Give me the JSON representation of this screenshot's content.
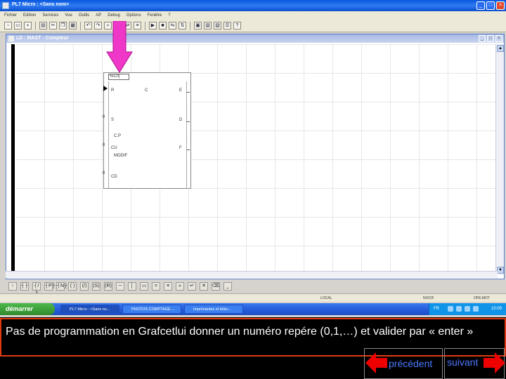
{
  "window": {
    "title": "PL7 Micro : <Sans nom>",
    "buttons": [
      "_",
      "□",
      "×"
    ]
  },
  "menu": [
    "Fichier",
    "Edition",
    "Services",
    "Vue",
    "Outils",
    "AP",
    "Debug",
    "Options",
    "Fenêtre",
    "?"
  ],
  "child_window": {
    "title": "LD : MAST - Compteur"
  },
  "counter_block": {
    "instance_field": "%C0|",
    "left_labels": [
      "R",
      "S",
      "C.P",
      "CU",
      "MODIF",
      "CD"
    ],
    "right_labels": [
      "C",
      "E",
      "D",
      "F"
    ],
    "left_pin_values": [
      "0",
      "0",
      "0"
    ]
  },
  "statusbar": {
    "items": [
      "LOCAL",
      "NOCIF",
      "OPE:MOT"
    ]
  },
  "taskbar": {
    "start_label": "démarrer",
    "tasks": [
      "PL7 Micro : <Sans no...",
      "PHOTOS COMPTAGE ...",
      "Imprimantes et téléc..."
    ],
    "lang": "FR",
    "clock": "10:09"
  },
  "slide": {
    "caption": "Pas de programmation en Grafcetlui donner un numéro repére (0,1,…) et valider par « enter »",
    "prev_label": "précédent",
    "next_label": "suivant",
    "accent_color": "#e03a10",
    "nav_text_color": "#4a78ff",
    "arrow_color": "#ee0000"
  }
}
